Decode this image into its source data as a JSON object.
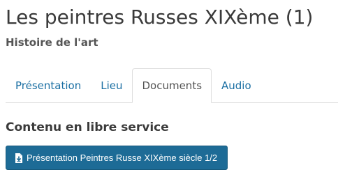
{
  "header": {
    "title": "Les peintres Russes XIXème (1)",
    "subtitle": "Histoire de l'art"
  },
  "tabs": [
    {
      "label": "Présentation",
      "active": false
    },
    {
      "label": "Lieu",
      "active": false
    },
    {
      "label": "Documents",
      "active": true
    },
    {
      "label": "Audio",
      "active": false
    }
  ],
  "content": {
    "section_heading": "Contenu en libre service",
    "document_button": {
      "label": "Présentation Peintres Russe XIXème siècle 1/2",
      "icon": "file-download-icon"
    }
  },
  "colors": {
    "link": "#1a6fa3",
    "button_bg": "#1d6b96",
    "text": "#3a3a3a"
  }
}
